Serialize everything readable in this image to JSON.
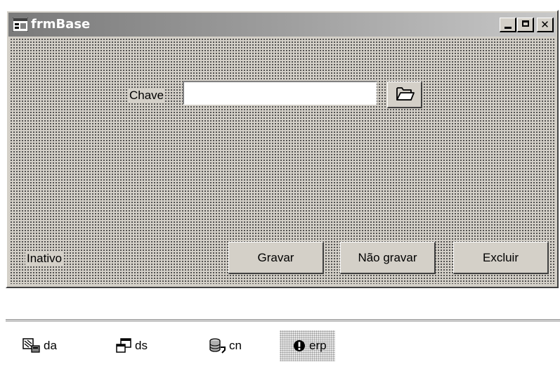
{
  "form": {
    "title": "frmBase",
    "caption_buttons": [
      "minimize",
      "maximize",
      "close"
    ],
    "chave_label": "Chave",
    "chave_value": "",
    "open_button_icon": "open-folder-icon",
    "status_label": "Inativo",
    "buttons": {
      "save": "Gravar",
      "dont_save": "Não gravar",
      "delete": "Excluir"
    }
  },
  "tray": {
    "items": [
      {
        "label": "da",
        "icon": "data-adapter-icon"
      },
      {
        "label": "ds",
        "icon": "dataset-icon"
      },
      {
        "label": "cn",
        "icon": "connection-icon"
      },
      {
        "label": "erp",
        "icon": "error-provider-icon",
        "selected": true
      }
    ]
  }
}
